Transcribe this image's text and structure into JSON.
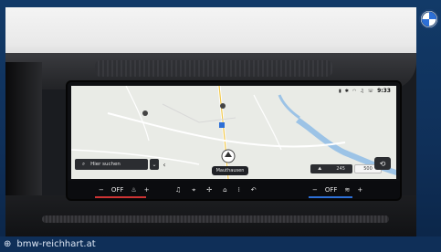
{
  "map": {
    "search_label": "Hier suchen",
    "destination_label": "Mauthausen"
  },
  "statusbar": {
    "time": "9:33"
  },
  "map_overlay": {
    "speed": "245",
    "scale": "500"
  },
  "climate_left": {
    "minus": "−",
    "state": "OFF",
    "plus": "+"
  },
  "climate_right": {
    "minus": "−",
    "state": "OFF",
    "plus": "+"
  },
  "footer": {
    "website": "bmw-reichhart.at"
  },
  "colors": {
    "frame_blue": "#0f2f58",
    "map_bg": "#e9ebe6",
    "river_blue": "#9cc3e6",
    "climate_red": "#cc3333",
    "climate_blue": "#2d6fd6"
  },
  "icons": [
    "globe-icon",
    "magnifier-icon",
    "chevron-down-icon",
    "chevron-left-icon",
    "music-note-icon",
    "nav-icon",
    "fan-icon",
    "home-icon",
    "grid-icon",
    "back-arrow-icon",
    "seat-heat-icon",
    "seat-vent-icon",
    "bmw-logo-icon"
  ]
}
